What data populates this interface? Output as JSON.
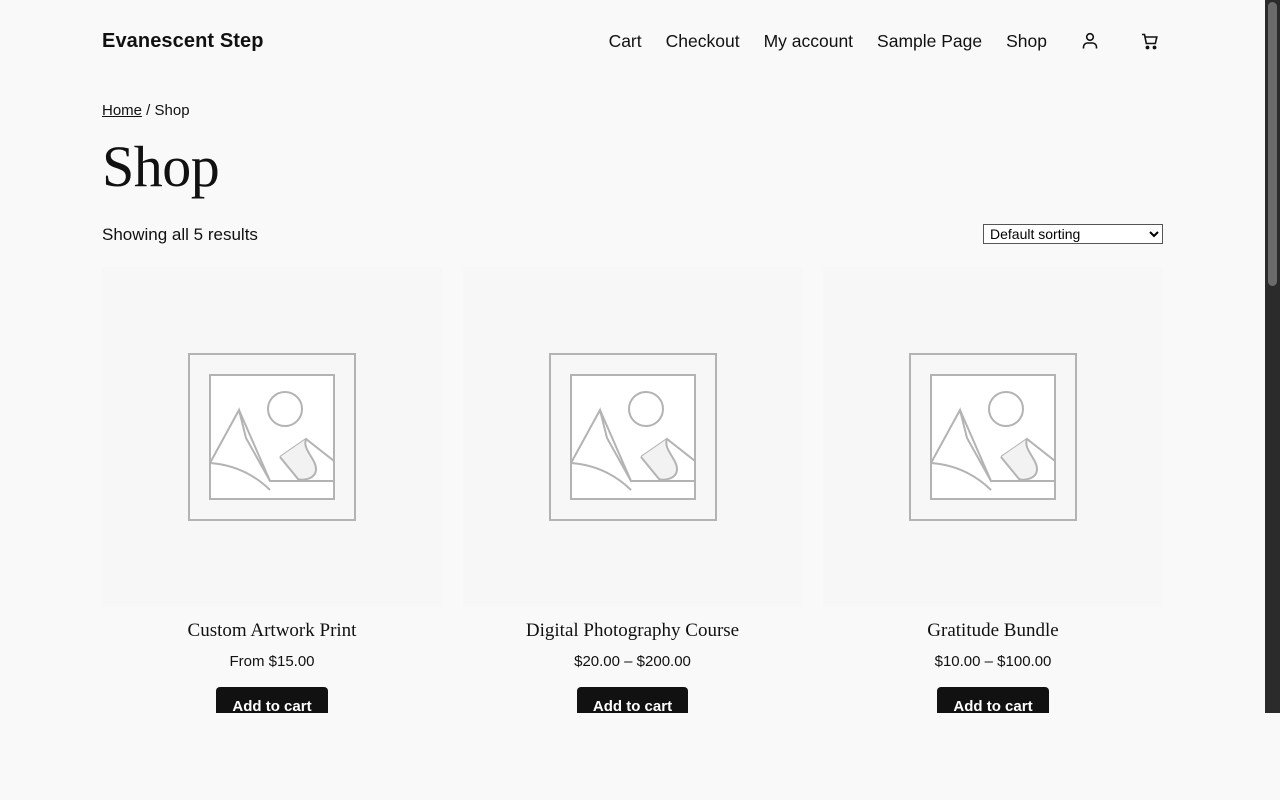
{
  "header": {
    "site_title": "Evanescent Step",
    "nav": [
      "Cart",
      "Checkout",
      "My account",
      "Sample Page",
      "Shop"
    ]
  },
  "breadcrumb": {
    "home": "Home",
    "separator": " / ",
    "current": "Shop"
  },
  "page_title": "Shop",
  "result_count": "Showing all 5 results",
  "sorting": {
    "selected": "Default sorting"
  },
  "products": [
    {
      "title": "Custom Artwork Print",
      "price": "From $15.00",
      "button": "Add to cart"
    },
    {
      "title": "Digital Photography Course",
      "price": "$20.00 – $200.00",
      "button": "Add to cart"
    },
    {
      "title": "Gratitude Bundle",
      "price": "$10.00 – $100.00",
      "button": "Add to cart"
    }
  ],
  "colors": {
    "background": "#f9f9f9",
    "button": "#111111",
    "image_bg": "#f6f7f6"
  },
  "icons": {
    "account": "user-icon",
    "cart": "shopping-cart-icon"
  }
}
